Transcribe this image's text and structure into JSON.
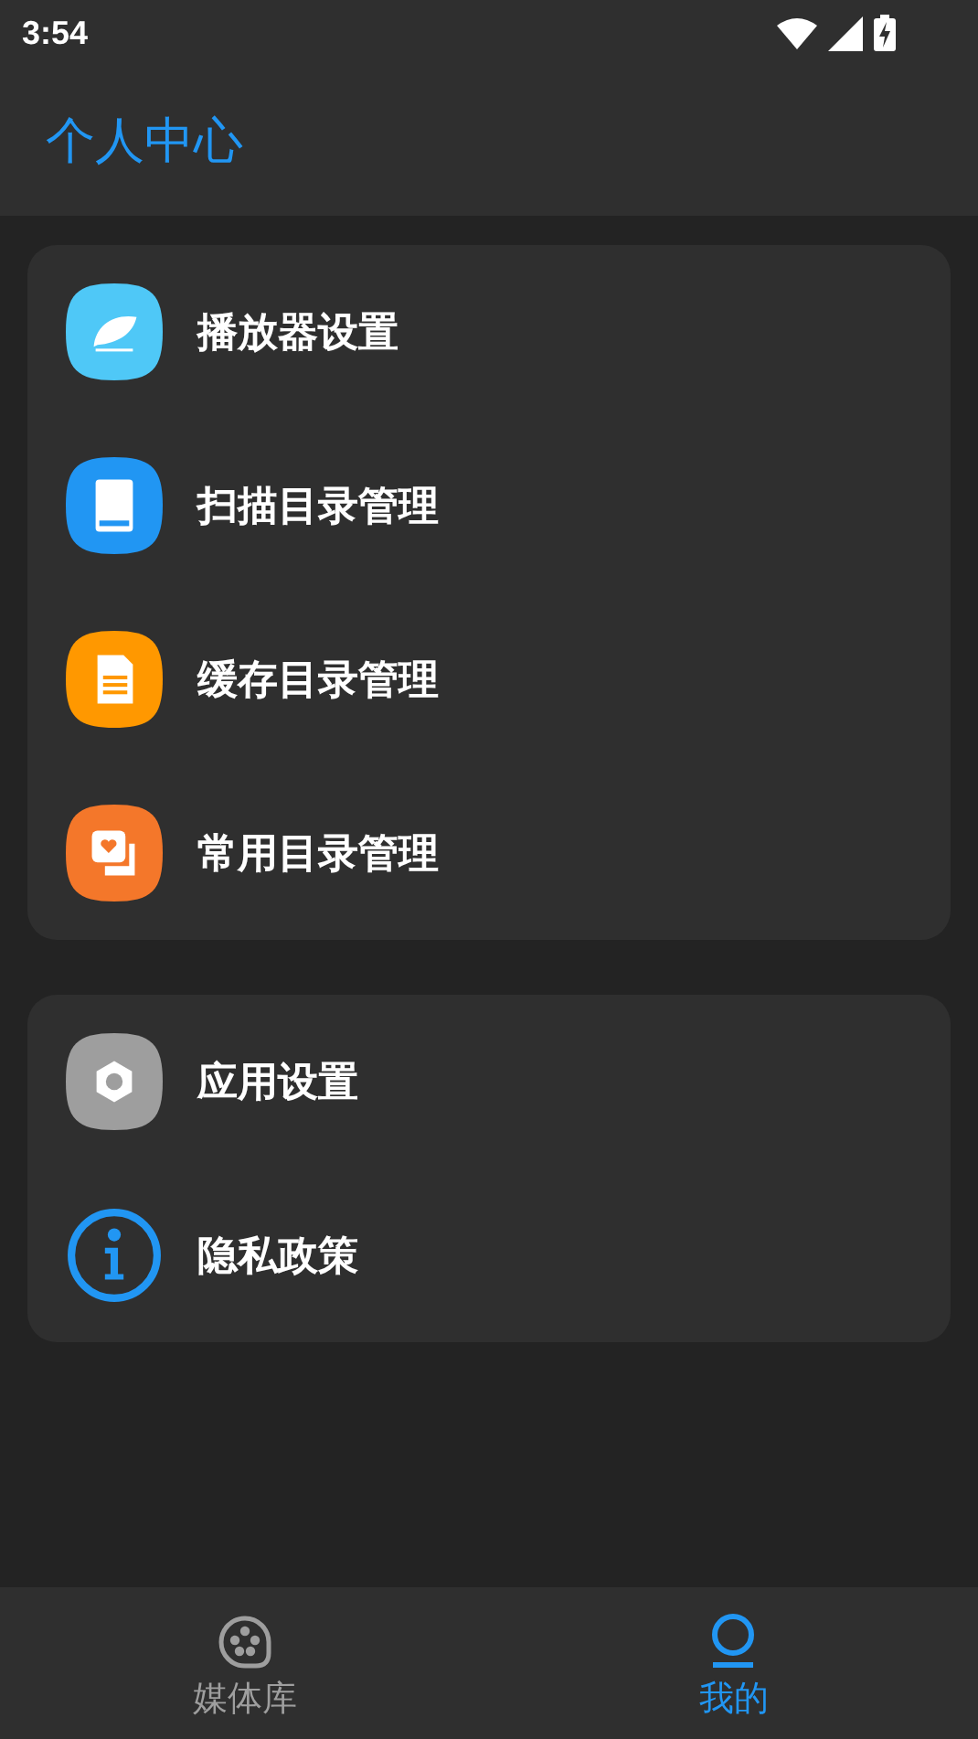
{
  "status_bar": {
    "time": "3:54"
  },
  "header": {
    "title": "个人中心"
  },
  "groups": [
    {
      "items": [
        {
          "label": "播放器设置",
          "kind": "feather",
          "color": "#4fc8f7"
        },
        {
          "label": "扫描目录管理",
          "kind": "book",
          "color": "#2196f3"
        },
        {
          "label": "缓存目录管理",
          "kind": "document",
          "color": "#ff9800"
        },
        {
          "label": "常用目录管理",
          "kind": "photos",
          "color": "#f4772a"
        }
      ]
    },
    {
      "items": [
        {
          "label": "应用设置",
          "kind": "gear",
          "color": "#9e9e9e"
        },
        {
          "label": "隐私政策",
          "kind": "info",
          "color": "#2196f3"
        }
      ]
    }
  ],
  "bottom_nav": [
    {
      "label": "媒体库",
      "kind": "reel",
      "selected": false
    },
    {
      "label": "我的",
      "kind": "person",
      "selected": true
    }
  ]
}
